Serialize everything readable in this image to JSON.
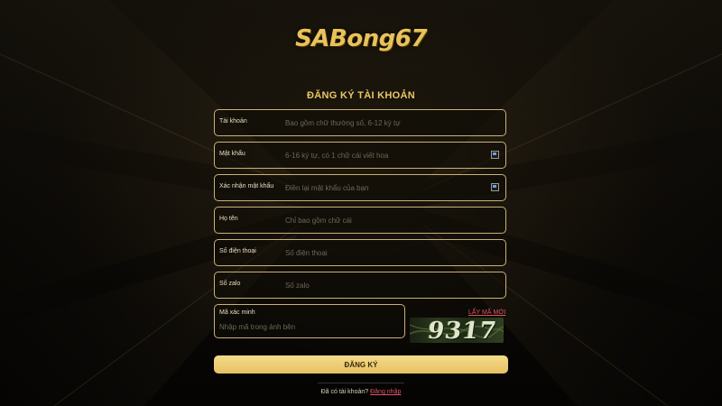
{
  "brand": {
    "logo_text": "SABong67"
  },
  "form": {
    "title": "ĐĂNG KÝ TÀI KHOẢN",
    "fields": [
      {
        "label": "Tài khoản",
        "placeholder": "Bao gồm chữ thường số, 6-12 ký tự",
        "value": ""
      },
      {
        "label": "Mật khẩu",
        "placeholder": "6-16 ký tự, có 1 chữ cái viết hoa",
        "value": ""
      },
      {
        "label": "Xác nhận mật khẩu",
        "placeholder": "Điền lại mật khẩu của bạn",
        "value": ""
      },
      {
        "label": "Họ tên",
        "placeholder": "Chỉ bao gồm chữ cái",
        "value": ""
      },
      {
        "label": "Số điện thoại",
        "placeholder": "Số điện thoại",
        "value": ""
      },
      {
        "label": "Số zalo",
        "placeholder": "Số zalo",
        "value": ""
      }
    ],
    "captcha": {
      "label": "Mã xác minh",
      "placeholder": "Nhập mã trong ảnh bên",
      "value": "",
      "refresh_label": "LẤY MÃ MỚI",
      "image_code": "9317"
    },
    "submit_label": "ĐĂNG KÝ"
  },
  "footer": {
    "prompt": "Đã có tài khoản?",
    "login_link": "Đăng nhập"
  },
  "colors": {
    "accent_gold": "#e9c766",
    "button_gold": "#f0d27a",
    "link_red": "#e05563",
    "background": "#0b0906"
  },
  "icons": {
    "password_toggle": "eye-icon"
  }
}
